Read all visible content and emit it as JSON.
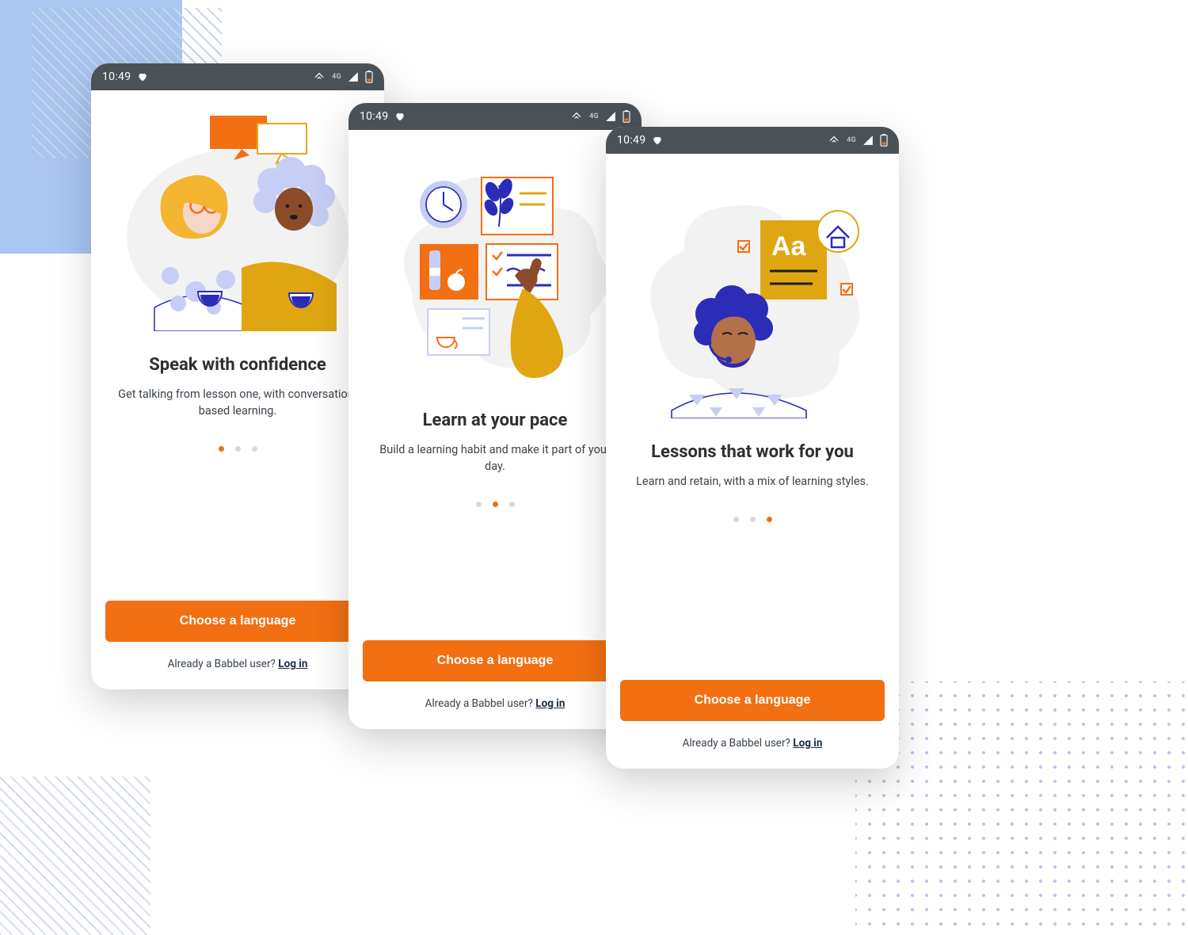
{
  "colors": {
    "accent": "#f26f12",
    "statusbar": "#4a5258",
    "cloud": "#f2f2f3",
    "indigo": "#b6bef2",
    "indigoLine": "#2b2cb8",
    "mustard": "#e0a612",
    "skin1": "#8b4b29",
    "skin2": "#b3714a",
    "hairYellow": "#f3b42f",
    "hairCurlyLilac": "#c7cef5"
  },
  "statusbar": {
    "time": "10:49",
    "network": "4G",
    "iconHeart": "heart-icon",
    "iconWifi": "wifi-icon",
    "iconSignal": "signal-icon",
    "iconBattery": "battery-icon"
  },
  "screens": [
    {
      "title": "Speak with confidence",
      "subtitle": "Get talking from lesson one, with conversation-based learning.",
      "cta": "Choose a language",
      "loginPrompt": "Already a Babbel user? ",
      "loginAction": "Log in",
      "pageActive": 0
    },
    {
      "title": "Learn at your pace",
      "subtitle": "Build a learning habit and make it part of your day.",
      "cta": "Choose a language",
      "loginPrompt": "Already a Babbel user? ",
      "loginAction": "Log in",
      "pageActive": 1
    },
    {
      "title": "Lessons that work for you",
      "subtitle": "Learn and retain, with a mix of learning styles.",
      "cta": "Choose a language",
      "loginPrompt": "Already a Babbel user? ",
      "loginAction": "Log in",
      "pageActive": 2
    }
  ],
  "pageCount": 3
}
